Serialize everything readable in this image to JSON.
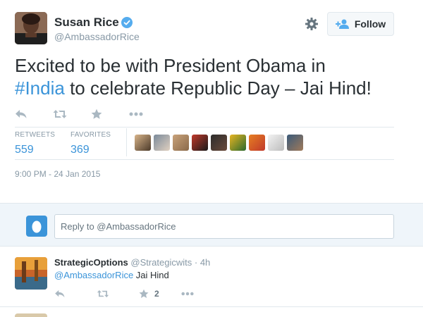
{
  "tweet": {
    "author_name": "Susan Rice",
    "author_handle": "@AmbassadorRice",
    "follow_label": "Follow",
    "text_before": "Excited to be with President Obama in",
    "hashtag": "#India",
    "text_after": " to celebrate Republic Day – Jai Hind!",
    "retweets_label": "RETWEETS",
    "retweets_count": "559",
    "favorites_label": "FAVORITES",
    "favorites_count": "369",
    "timestamp": "9:00 PM - 24 Jan 2015"
  },
  "composer": {
    "placeholder": "Reply to @AmbassadorRice"
  },
  "replies": [
    {
      "name": "StrategicOptions",
      "handle": "@Strategicwits",
      "time": "· 4h",
      "mention": "@AmbassadorRice",
      "text": " Jai Hind",
      "favorites": "2"
    }
  ],
  "next_reply": {
    "name": "",
    "handle": ""
  },
  "colors": {
    "link": "#3b94d9",
    "text": "#292f33",
    "muted": "#8899a6",
    "action": "#aab8c2",
    "reply_bg": "#eff5fa"
  }
}
